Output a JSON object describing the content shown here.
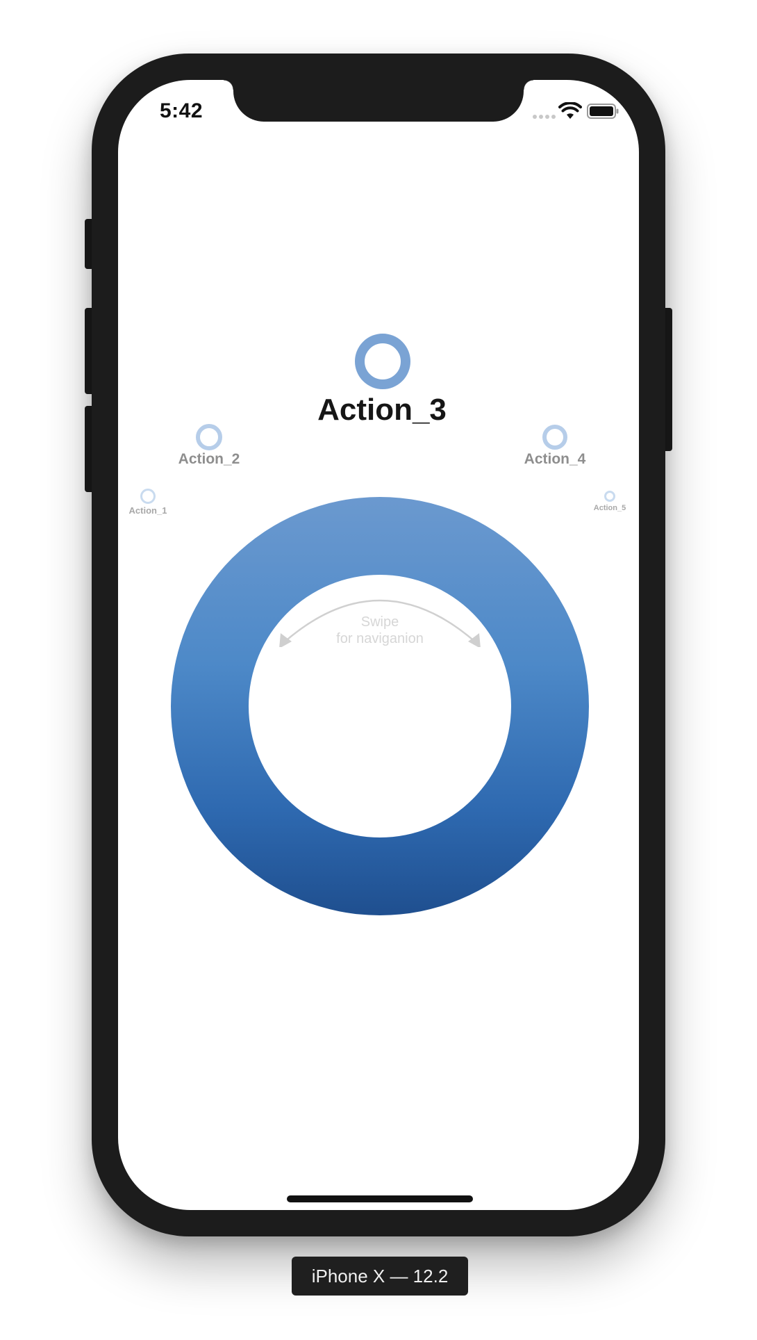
{
  "status_bar": {
    "time": "5:42"
  },
  "wheel": {
    "hint_line1": "Swipe",
    "hint_line2": "for naviganion",
    "gradient_top": "#6b99cf",
    "gradient_bottom": "#1f4f8f"
  },
  "actions": [
    {
      "label": "Action_1",
      "state": "far"
    },
    {
      "label": "Action_2",
      "state": "near"
    },
    {
      "label": "Action_3",
      "state": "selected"
    },
    {
      "label": "Action_4",
      "state": "near"
    },
    {
      "label": "Action_5",
      "state": "far"
    }
  ],
  "colors": {
    "selected_ring": "#7aa3d4",
    "near_ring": "#b6cde9",
    "far_ring": "#c9dbef"
  },
  "device_badge": "iPhone X — 12.2"
}
